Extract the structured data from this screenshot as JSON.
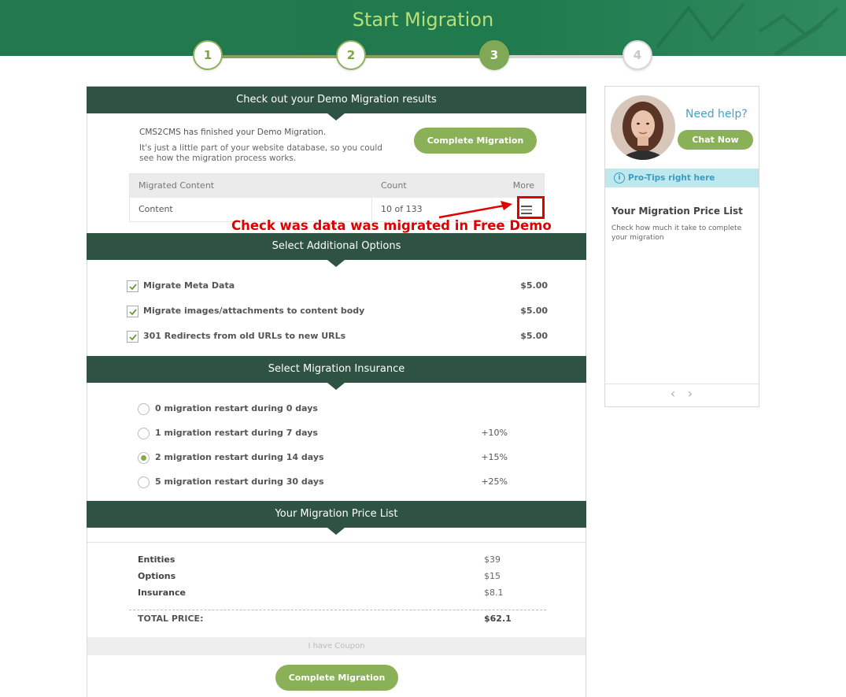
{
  "header": {
    "title": "Start Migration"
  },
  "steps": [
    "1",
    "2",
    "3",
    "4"
  ],
  "demo_results": {
    "heading": "Check out your Demo Migration results",
    "intro_line1": "CMS2CMS has finished your Demo Migration.",
    "intro_line2": "It's just a little part of your website database, so you could see how the migration process works.",
    "complete_button": "Complete Migration",
    "table": {
      "headers": [
        "Migrated Content",
        "Count",
        "More"
      ],
      "rows": [
        {
          "content": "Content",
          "count": "10 of 133"
        }
      ]
    },
    "annotation": "Check was data was migrated in Free Demo"
  },
  "additional_options": {
    "heading": "Select Additional Options",
    "items": [
      {
        "label": "Migrate Meta Data",
        "price": "$5.00",
        "checked": true
      },
      {
        "label": "Migrate images/attachments to content body",
        "price": "$5.00",
        "checked": true
      },
      {
        "label": "301 Redirects from old URLs to new URLs",
        "price": "$5.00",
        "checked": true
      }
    ]
  },
  "insurance": {
    "heading": "Select Migration Insurance",
    "items": [
      {
        "label": "0 migration restart during 0 days",
        "percent": "",
        "selected": false
      },
      {
        "label": "1 migration restart during 7 days",
        "percent": "+10%",
        "selected": false
      },
      {
        "label": "2 migration restart during 14 days",
        "percent": "+15%",
        "selected": true
      },
      {
        "label": "5 migration restart during 30 days",
        "percent": "+25%",
        "selected": false
      }
    ]
  },
  "price_list": {
    "heading": "Your Migration Price List",
    "rows": [
      {
        "label": "Entities",
        "value": "$39"
      },
      {
        "label": "Options",
        "value": "$15"
      },
      {
        "label": "Insurance",
        "value": "$8.1"
      }
    ],
    "total_label": "TOTAL PRICE:",
    "total_value": "$62.1",
    "coupon": "I have Coupon",
    "complete_button": "Complete Migration"
  },
  "sidebar": {
    "need_help": "Need help?",
    "chat_button": "Chat Now",
    "tips_label": "Pro-Tips right here",
    "tip_title": "Your Migration Price List",
    "tip_text": "Check how much it take to complete your migration",
    "prev": "‹",
    "next": "›"
  },
  "colors": {
    "header_green": "#23784f",
    "section_header": "#2f5342",
    "button_green": "#8ab058",
    "annotation_red": "#e00000",
    "help_blue": "#4a9fc6"
  }
}
